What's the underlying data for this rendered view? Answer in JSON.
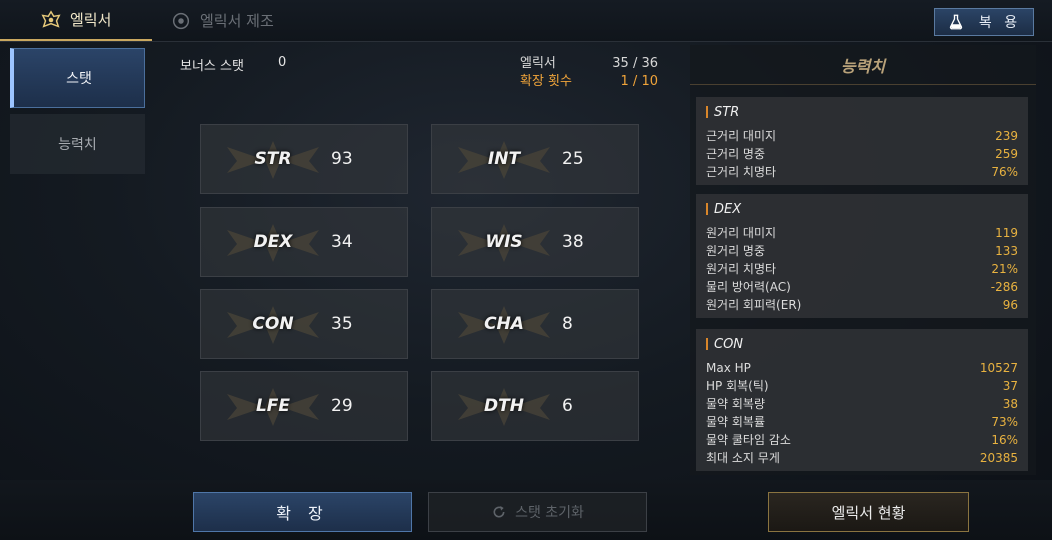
{
  "tabs": [
    {
      "label": "엘릭서",
      "icon": "elixir-crest-icon"
    },
    {
      "label": "엘릭서 제조",
      "icon": "elixir-craft-icon"
    }
  ],
  "restore_button": {
    "label": "복 용",
    "icon": "potion-flask-icon"
  },
  "sidebar": {
    "items": [
      {
        "label": "스탯"
      },
      {
        "label": "능력치"
      }
    ]
  },
  "bonus_stat": {
    "label": "보너스 스탯",
    "value": "0"
  },
  "elixir_count": {
    "label": "엘릭서",
    "value": "35 / 36"
  },
  "expand_count": {
    "label": "확장 횟수",
    "value": "1 / 10"
  },
  "stats": [
    {
      "name": "STR",
      "value": "93"
    },
    {
      "name": "INT",
      "value": "25"
    },
    {
      "name": "DEX",
      "value": "34"
    },
    {
      "name": "WIS",
      "value": "38"
    },
    {
      "name": "CON",
      "value": "35"
    },
    {
      "name": "CHA",
      "value": "8"
    },
    {
      "name": "LFE",
      "value": "29"
    },
    {
      "name": "DTH",
      "value": "6"
    }
  ],
  "ability_panel": {
    "title": "능력치",
    "sections": [
      {
        "name": "STR",
        "rows": [
          {
            "label": "근거리 대미지",
            "value": "239"
          },
          {
            "label": "근거리 명중",
            "value": "259"
          },
          {
            "label": "근거리 치명타",
            "value": "76%"
          }
        ]
      },
      {
        "name": "DEX",
        "rows": [
          {
            "label": "원거리 대미지",
            "value": "119"
          },
          {
            "label": "원거리 명중",
            "value": "133"
          },
          {
            "label": "원거리 치명타",
            "value": "21%"
          },
          {
            "label": "물리 방어력(AC)",
            "value": "-286"
          },
          {
            "label": "원거리 회피력(ER)",
            "value": "96"
          }
        ]
      },
      {
        "name": "CON",
        "rows": [
          {
            "label": "Max HP",
            "value": "10527"
          },
          {
            "label": "HP 회복(틱)",
            "value": "37"
          },
          {
            "label": "물약 회복량",
            "value": "38"
          },
          {
            "label": "물약 회복률",
            "value": "73%"
          },
          {
            "label": "물약 쿨타임 감소",
            "value": "16%"
          },
          {
            "label": "최대 소지 무게",
            "value": "20385"
          }
        ]
      }
    ]
  },
  "buttons": {
    "expand": "확 장",
    "reset": "스탯 초기화",
    "status": "엘릭서 현황"
  },
  "colors": {
    "accent_blue": "#2b4467",
    "accent_gold": "#caa860",
    "value_orange": "#e8b240"
  }
}
